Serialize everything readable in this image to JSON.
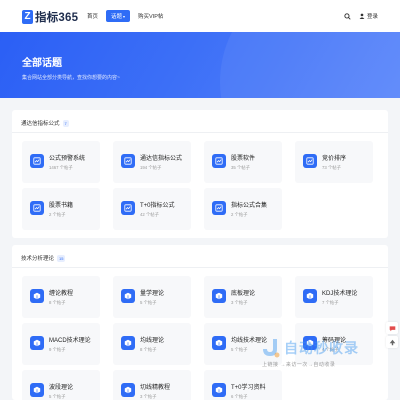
{
  "header": {
    "logo_mark": "Z",
    "logo_text": "指标365",
    "nav": [
      {
        "label": "首页",
        "active": false
      },
      {
        "label": "话题",
        "active": true
      },
      {
        "label": "购买VIP帖",
        "active": false
      }
    ],
    "login_label": "登录"
  },
  "hero": {
    "title": "全部话题",
    "desc": "集合网站全部分类导航，查找你想要的内容~"
  },
  "sections": [
    {
      "title": "通达信指标公式",
      "count": "7",
      "cards": [
        {
          "name": "公式预警系统",
          "count": "1467 个帖子"
        },
        {
          "name": "通达信指标公式",
          "count": "194 个帖子"
        },
        {
          "name": "股票软件",
          "count": "35 个帖子"
        },
        {
          "name": "竞价排序",
          "count": "73 个帖子"
        },
        {
          "name": "股票书籍",
          "count": "2 个帖子"
        },
        {
          "name": "T+0指标公式",
          "count": "42 个帖子"
        },
        {
          "name": "指标公式合集",
          "count": "2 个帖子"
        }
      ]
    },
    {
      "title": "技术分析理论",
      "count": "15",
      "cards": [
        {
          "name": "缠论教程",
          "count": "8 个帖子"
        },
        {
          "name": "量学理论",
          "count": "5 个帖子"
        },
        {
          "name": "底板理论",
          "count": "3 个帖子"
        },
        {
          "name": "KDJ技术理论",
          "count": "7 个帖子"
        },
        {
          "name": "MACD技术理论",
          "count": "9 个帖子"
        },
        {
          "name": "均线理论",
          "count": "8 个帖子"
        },
        {
          "name": "均线技术理论",
          "count": "5 个帖子"
        },
        {
          "name": "筹码理论",
          "count": "4 个帖子"
        },
        {
          "name": "波段理论",
          "count": "5 个帖子"
        },
        {
          "name": "切线精教程",
          "count": "3 个帖子"
        },
        {
          "name": "T+0学习资料",
          "count": "6 个帖子"
        }
      ]
    }
  ],
  "watermark": {
    "title": "自动秒收录",
    "sub": "上链接 →来访一次→自动收录"
  },
  "colors": {
    "accent": "#2f6cf6",
    "card_bg": "#f7f8fa",
    "page_bg": "#f3f5f8"
  }
}
